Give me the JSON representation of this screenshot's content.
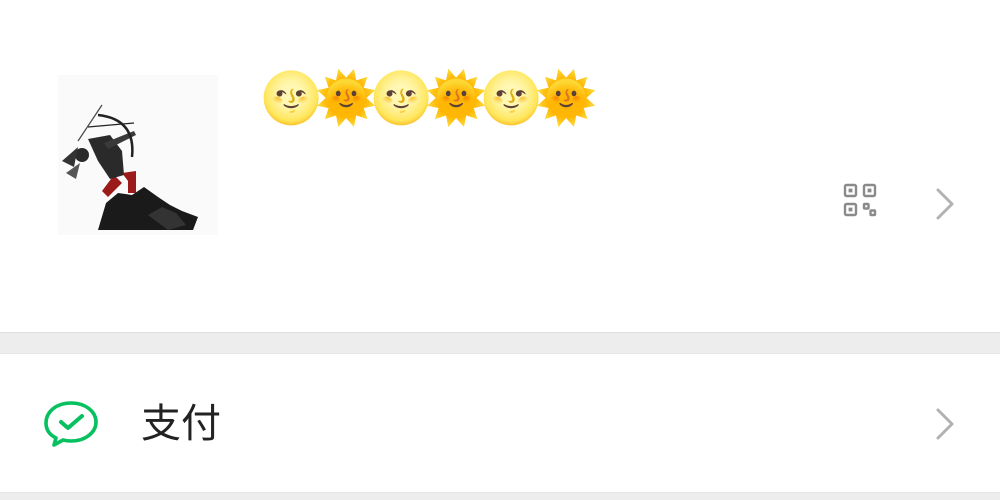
{
  "profile": {
    "avatar_icon": "archer-avatar",
    "nickname_glyphs": [
      "🌝",
      "🌞",
      "🌝",
      "🌞",
      "🌝",
      "🌞"
    ],
    "qr_icon": "qr-code-icon",
    "chevron_icon": "chevron-right-icon"
  },
  "menu": {
    "pay": {
      "label": "支付",
      "icon": "wechat-pay-icon",
      "icon_color": "#07c160"
    }
  },
  "colors": {
    "background": "#ffffff",
    "separator": "#ededed",
    "chevron": "#b2b2b2",
    "text": "#222222"
  }
}
